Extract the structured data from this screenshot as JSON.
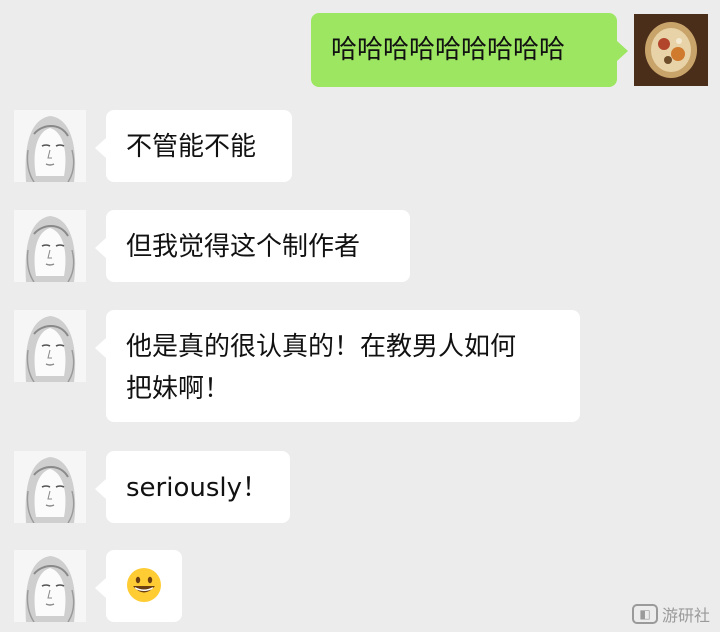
{
  "messages": [
    {
      "side": "out",
      "text": "哈哈哈哈哈哈哈哈哈"
    },
    {
      "side": "in",
      "text": "不管能不能"
    },
    {
      "side": "in",
      "text": "但我觉得这个制作者"
    },
    {
      "side": "in",
      "lines": [
        "他是真的很认真的！在教男人如何",
        "把妹啊！"
      ]
    },
    {
      "side": "in",
      "text": "seriously！"
    },
    {
      "side": "in",
      "emoji": "grinning-face-emoji"
    }
  ],
  "watermark": {
    "icon": "game-controller-icon",
    "text": "游研社"
  },
  "colors": {
    "background": "#ececec",
    "bubble_out": "#9de661",
    "bubble_in": "#ffffff"
  }
}
